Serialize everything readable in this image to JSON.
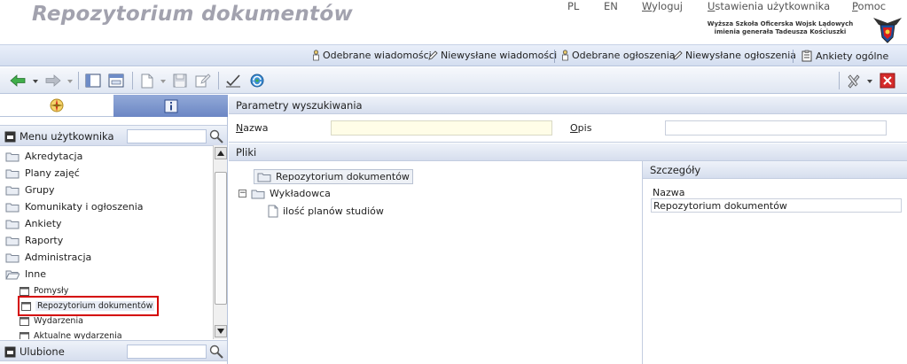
{
  "header": {
    "title": "Repozytorium dokumentów",
    "lang_pl": "PL",
    "lang_en": "EN",
    "logout": "Wyloguj",
    "user_settings": "Ustawienia użytkownika",
    "help": "Pomoc",
    "school_line1": "Wyższa Szkoła Oficerska Wojsk Lądowych",
    "school_line2": "imienia generała Tadeusza Kościuszki"
  },
  "notifications": {
    "received_messages": "Odebrane wiadomości",
    "unsent_messages": "Niewysłane wiadomości",
    "received_announcements": "Odebrane ogłoszenia",
    "unsent_announcements": "Niewysłane ogłoszenia",
    "surveys": "Ankiety ogólne"
  },
  "sidebar": {
    "user_menu_title": "Menu użytkownika",
    "favorites_title": "Ulubione",
    "items": [
      {
        "label": "Akredytacja"
      },
      {
        "label": "Plany zajęć"
      },
      {
        "label": "Grupy"
      },
      {
        "label": "Komunikaty i ogłoszenia"
      },
      {
        "label": "Ankiety"
      },
      {
        "label": "Raporty"
      },
      {
        "label": "Administracja"
      },
      {
        "label": "Inne"
      }
    ],
    "subitems": [
      {
        "label": "Pomysły"
      },
      {
        "label": "Repozytorium dokumentów"
      },
      {
        "label": "Wydarzenia"
      },
      {
        "label": "Aktualne wydarzenia"
      }
    ]
  },
  "search_params": {
    "title": "Parametry wyszukiwania",
    "name_label": "Nazwa",
    "name_value": "",
    "desc_label": "Opis",
    "desc_value": ""
  },
  "files": {
    "title": "Pliki",
    "root": "Repozytorium dokumentów",
    "folder": "Wykładowca",
    "file": "ilość planów studiów",
    "expander": "−"
  },
  "details": {
    "title": "Szczegóły",
    "name_label": "Nazwa",
    "name_value": "Repozytorium dokumentów"
  },
  "colors": {
    "accent": "#6b86c4",
    "selection_outline": "#d40000",
    "title_gray": "#a2a2ae"
  }
}
